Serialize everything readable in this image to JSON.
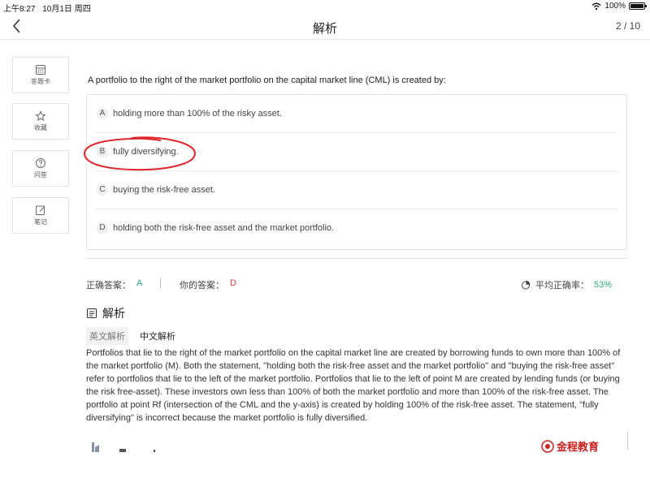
{
  "status": {
    "time": "上午8:27",
    "date": "10月1日 周四",
    "battery": "100%"
  },
  "nav": {
    "title": "解析",
    "page": "2 / 10"
  },
  "sidebar": {
    "items": [
      {
        "label": "答题卡",
        "icon": "answer-card-icon"
      },
      {
        "label": "收藏",
        "icon": "star-icon"
      },
      {
        "label": "问答",
        "icon": "question-icon"
      },
      {
        "label": "笔记",
        "icon": "note-icon"
      }
    ]
  },
  "question": {
    "text": "A portfolio to the right of the market portfolio on the capital market line (CML) is created by:",
    "options": [
      {
        "letter": "A",
        "text": "holding more than 100% of the risky asset."
      },
      {
        "letter": "B",
        "text": "fully diversifying."
      },
      {
        "letter": "C",
        "text": "buying the risk-free asset."
      },
      {
        "letter": "D",
        "text": "holding both the risk-free asset and the market portfolio."
      }
    ]
  },
  "result": {
    "correct_label": "正确答案：",
    "correct_value": "A",
    "yours_label": "你的答案：",
    "yours_value": "D",
    "avg_label": "平均正确率：",
    "avg_value": "53%"
  },
  "analysis": {
    "title": "解析",
    "tabs": [
      "英文解析",
      "中文解析"
    ],
    "text": "Portfolios that lie to the right of the market portfolio on the capital market line are created by borrowing funds to own more than 100% of the market portfolio (M). Both the statement, \"holding both the risk-free asset and the market portfolio\" and \"buying the risk-free asset\" refer to portfolios that lie to the left of the market portfolio. Portfolios that lie to the left of point M are created by lending funds (or buying the risk free-asset). These investors own less than 100% of both the market portfolio and more than 100% of the risk-free asset. The portfolio at point Rf (intersection of the CML and the y-axis) is created by holding 100% of the risk-free asset. The statement, \"fully diversifying\" is incorrect because the market portfolio is fully diversified."
  },
  "footer": {
    "logo_text": "金程教育"
  },
  "colors": {
    "correct": "#2aa876",
    "wrong": "#e2463c",
    "annotation": "#e0242b",
    "brand": "#c9211e"
  }
}
